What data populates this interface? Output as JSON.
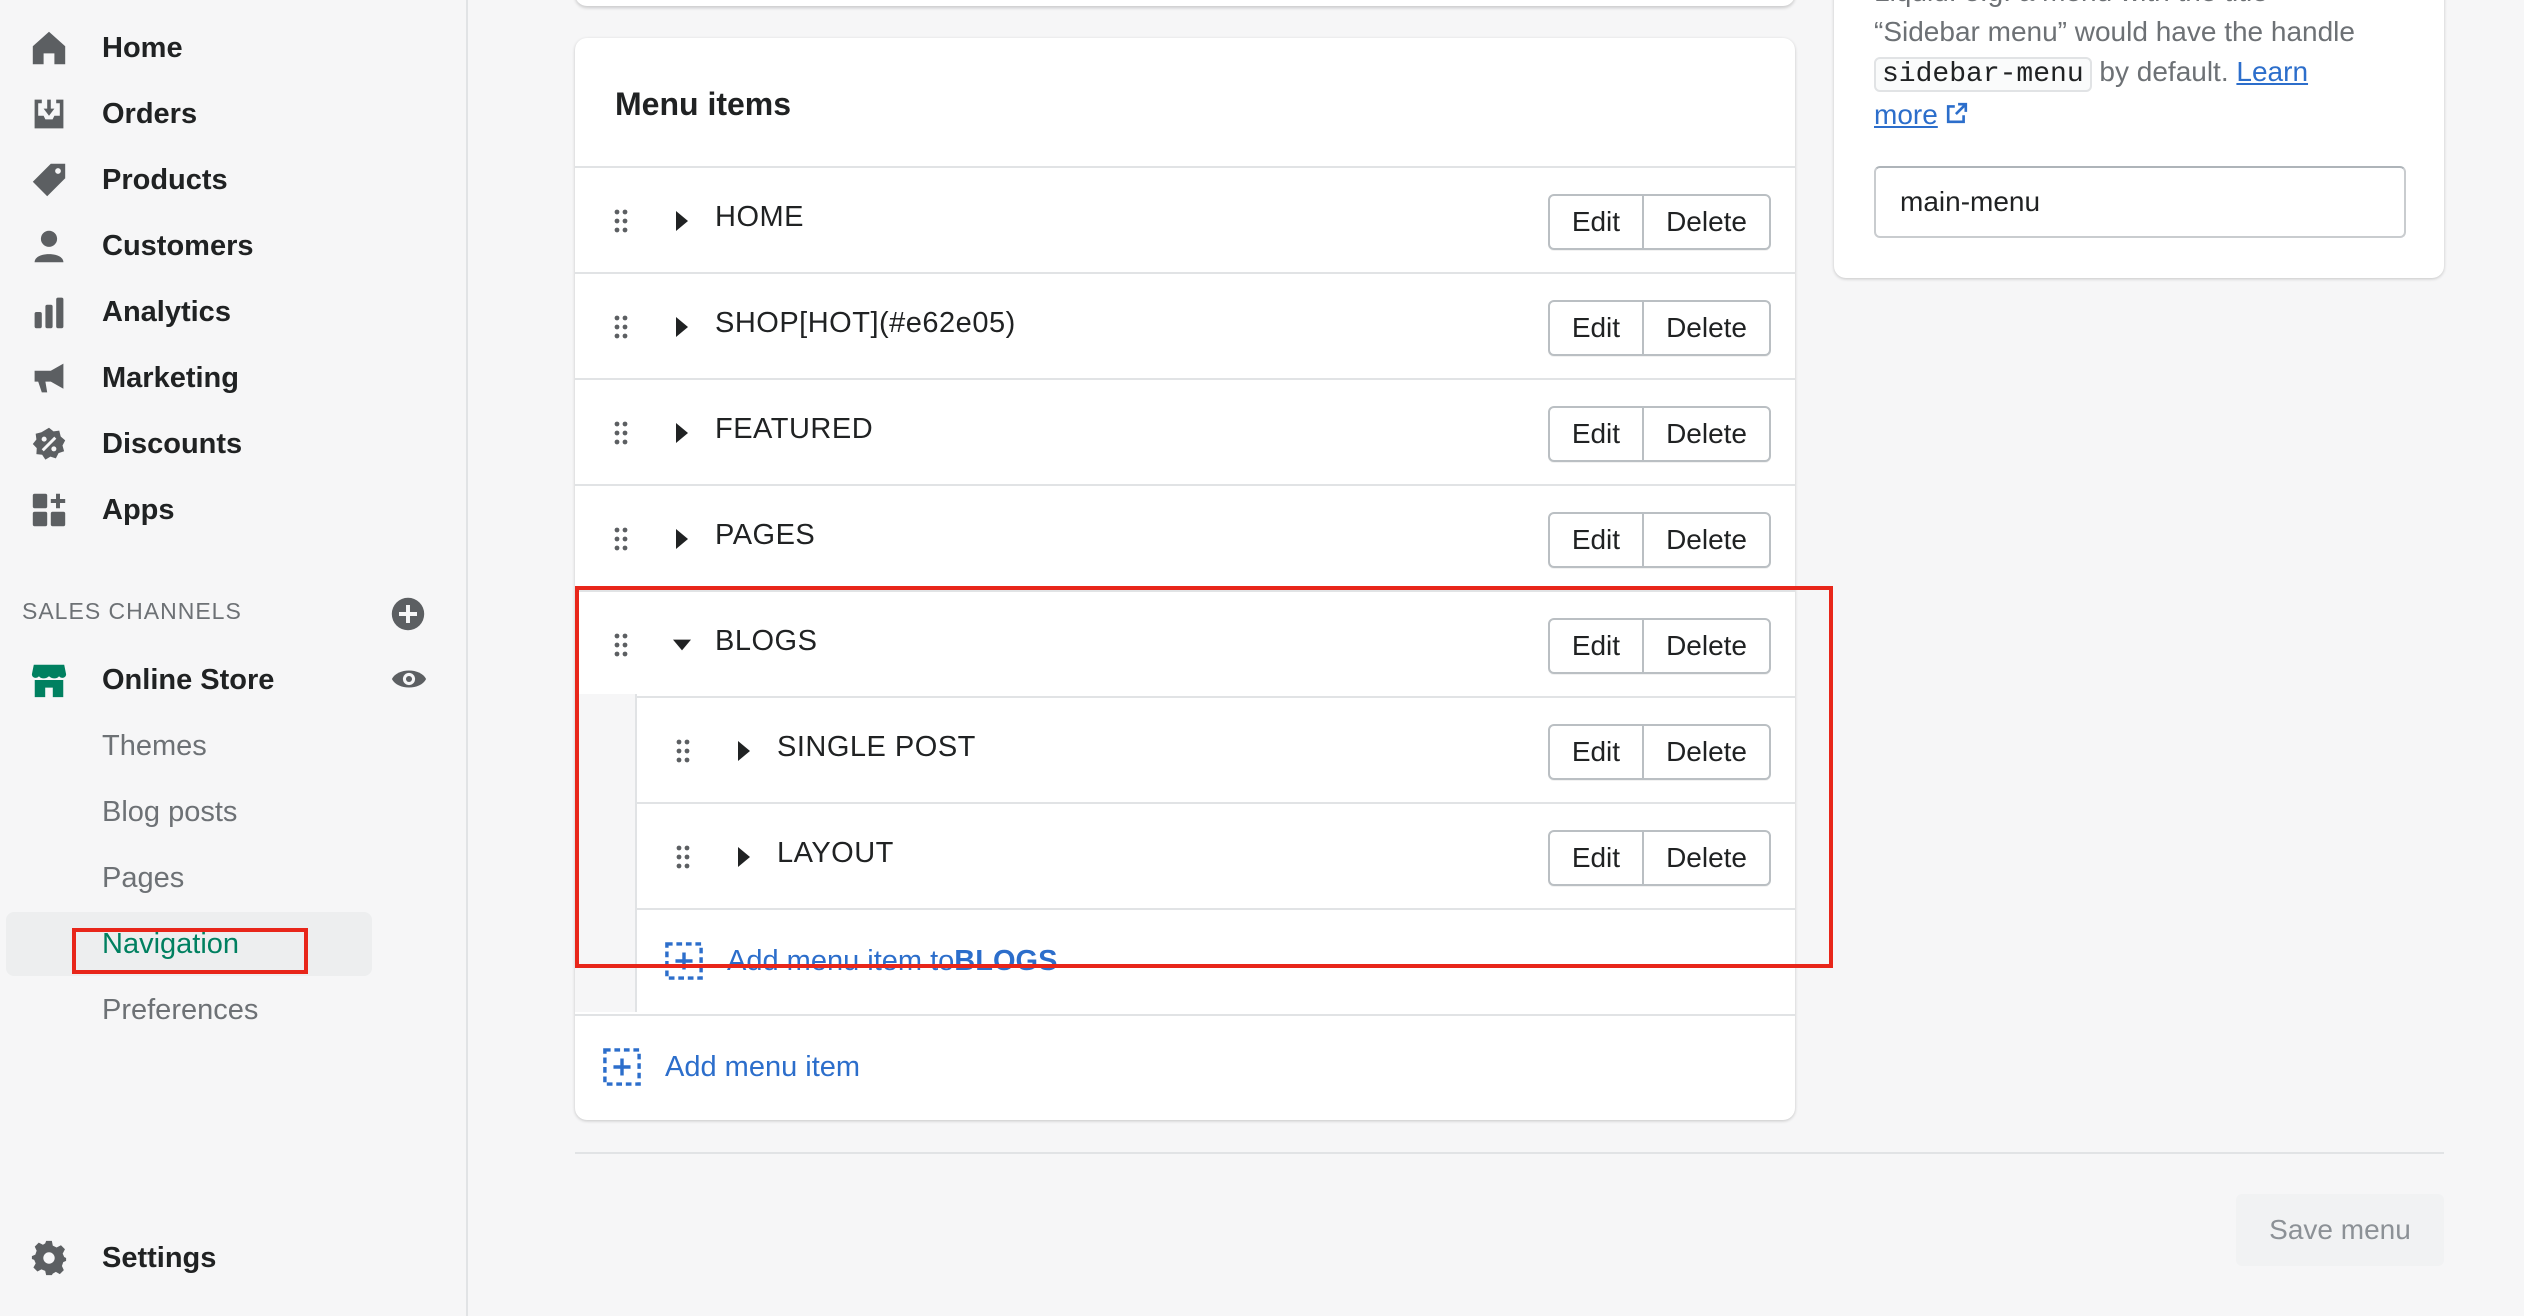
{
  "sidebar": {
    "main_items": [
      {
        "label": "Home",
        "icon": "home-icon"
      },
      {
        "label": "Orders",
        "icon": "orders-icon"
      },
      {
        "label": "Products",
        "icon": "tag-icon"
      },
      {
        "label": "Customers",
        "icon": "person-icon"
      },
      {
        "label": "Analytics",
        "icon": "bar-chart-icon"
      },
      {
        "label": "Marketing",
        "icon": "megaphone-icon"
      },
      {
        "label": "Discounts",
        "icon": "discount-icon"
      },
      {
        "label": "Apps",
        "icon": "apps-icon"
      }
    ],
    "sales_channels_header": "SALES CHANNELS",
    "online_store": {
      "label": "Online Store",
      "icon": "store-icon"
    },
    "online_store_subitems": [
      {
        "label": "Themes"
      },
      {
        "label": "Blog posts"
      },
      {
        "label": "Pages"
      },
      {
        "label": "Navigation",
        "active": true
      },
      {
        "label": "Preferences"
      }
    ],
    "settings": {
      "label": "Settings",
      "icon": "gear-icon"
    }
  },
  "menu_card": {
    "title": "Menu items",
    "edit_label": "Edit",
    "delete_label": "Delete",
    "items": [
      {
        "label": "HOME",
        "expanded": false
      },
      {
        "label": "SHOP[HOT](#e62e05)",
        "expanded": false
      },
      {
        "label": "FEATURED",
        "expanded": false
      },
      {
        "label": "PAGES",
        "expanded": false
      },
      {
        "label": "BLOGS",
        "expanded": true
      }
    ],
    "blog_children": [
      {
        "label": "SINGLE POST"
      },
      {
        "label": "LAYOUT"
      }
    ],
    "add_to_blogs_prefix": "Add menu item to ",
    "add_to_blogs_target": "BLOGS",
    "add_item_label": "Add menu item"
  },
  "handle_card": {
    "help_line1": "Liquid. e.g. a menu with the title",
    "help_line2": "“Sidebar menu” would have the handle",
    "help_code": "sidebar-menu",
    "help_after_code": " by default. ",
    "learn": "Learn",
    "more": "more",
    "handle_value": "main-menu"
  },
  "footer": {
    "save_label": "Save menu"
  },
  "colors": {
    "accent_green": "#008060",
    "link_blue": "#2c6ecb",
    "highlight_red": "#e8261a"
  }
}
